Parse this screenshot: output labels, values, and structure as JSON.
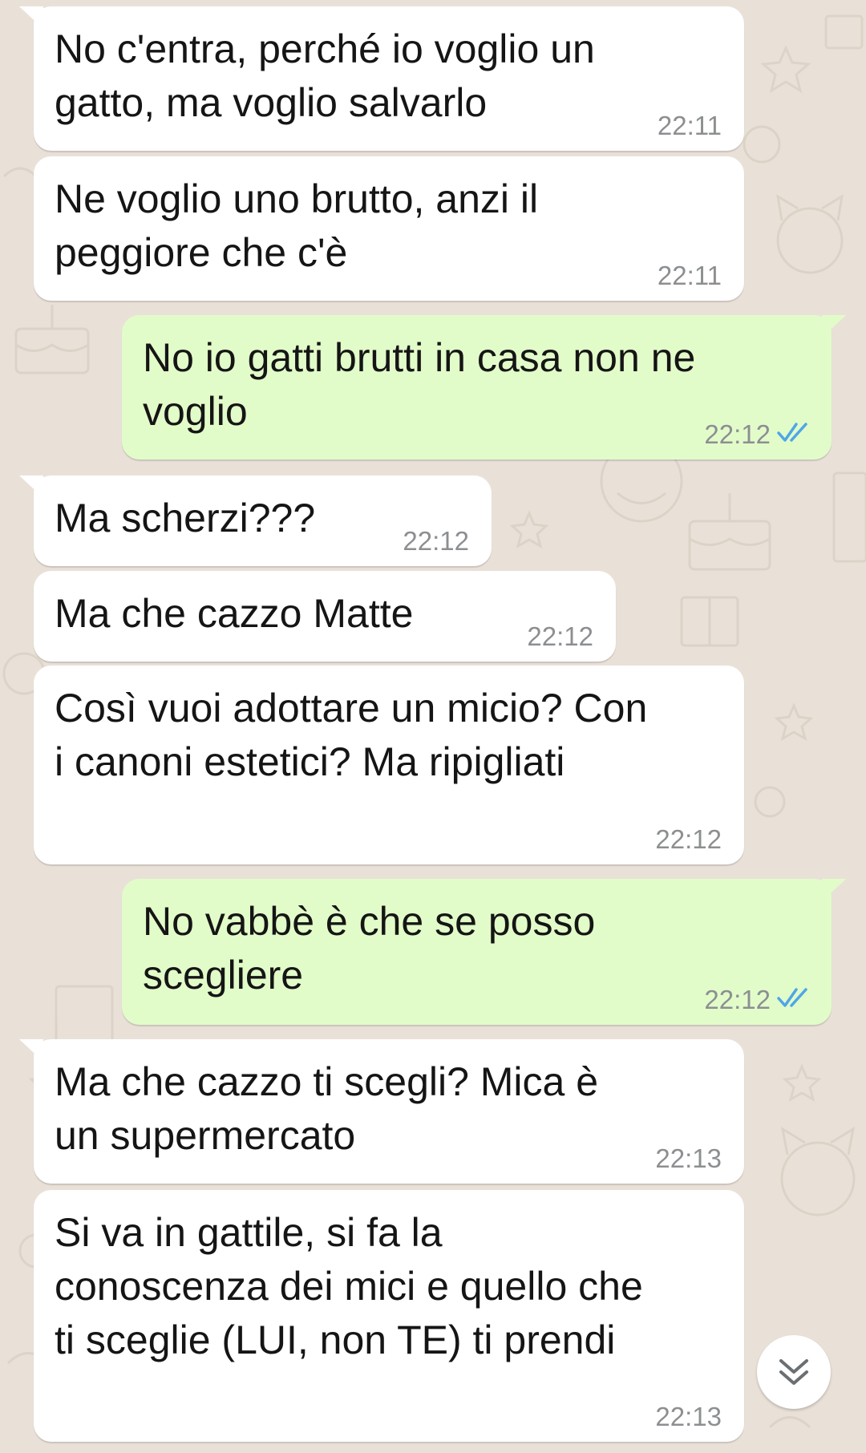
{
  "colors": {
    "background": "#e9e1d8",
    "incoming_bubble": "#ffffff",
    "outgoing_bubble": "#e2fcc9",
    "read_ticks": "#4fa6e8",
    "timestamp": "#8c8f92"
  },
  "messages": [
    {
      "direction": "in",
      "text": "No c'entra, perché io voglio un\ngatto, ma voglio salvarlo",
      "time": "22:11"
    },
    {
      "direction": "in",
      "text": "Ne voglio uno brutto, anzi il\npeggiore che c'è",
      "time": "22:11"
    },
    {
      "direction": "out",
      "text": "No io gatti brutti in casa non ne\nvoglio",
      "time": "22:12",
      "status": "read-ticks-icon"
    },
    {
      "direction": "in",
      "text": "Ma scherzi???",
      "time": "22:12"
    },
    {
      "direction": "in",
      "text": "Ma che cazzo Matte",
      "time": "22:12"
    },
    {
      "direction": "in",
      "text": "Così vuoi adottare un micio? Con\ni canoni estetici? Ma ripigliati",
      "time": "22:12"
    },
    {
      "direction": "out",
      "text": "No vabbè è che se posso\nscegliere",
      "time": "22:12",
      "status": "read-ticks-icon"
    },
    {
      "direction": "in",
      "text": "Ma che cazzo ti scegli? Mica è\nun supermercato",
      "time": "22:13"
    },
    {
      "direction": "in",
      "text": "Si va in gattile, si fa la\nconoscenza dei mici e quello che\nti sceglie (LUI, non TE) ti prendi",
      "time": "22:13"
    }
  ],
  "scroll_button": {
    "icon": "double-chevron-down-icon"
  }
}
